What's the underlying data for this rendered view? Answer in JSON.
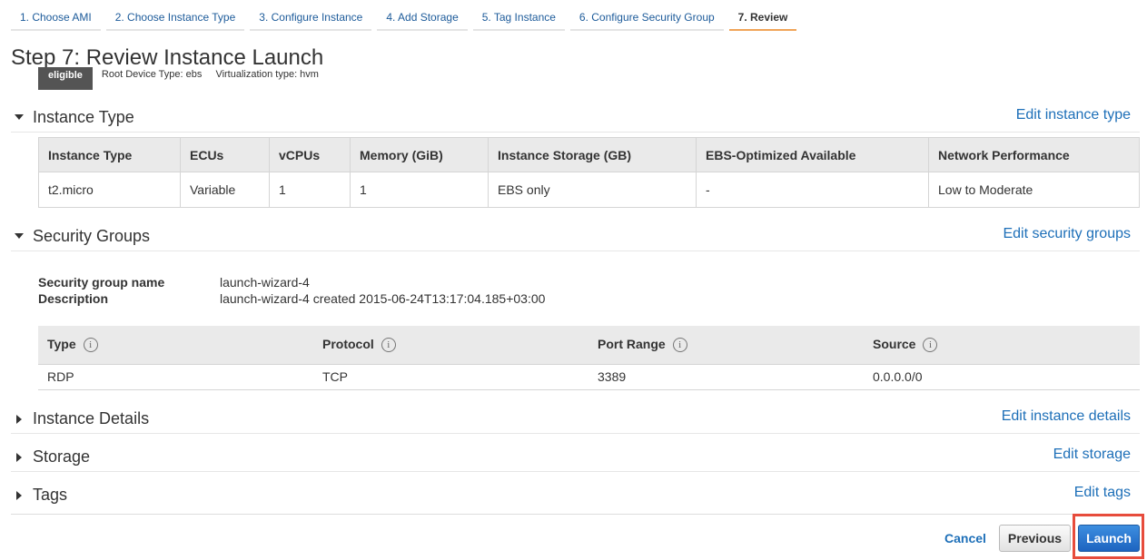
{
  "wizard": {
    "steps": [
      {
        "label": "1. Choose AMI"
      },
      {
        "label": "2. Choose Instance Type"
      },
      {
        "label": "3. Configure Instance"
      },
      {
        "label": "4. Add Storage"
      },
      {
        "label": "5. Tag Instance"
      },
      {
        "label": "6. Configure Security Group"
      },
      {
        "label": "7. Review"
      }
    ],
    "active_step": "7. Review"
  },
  "page_title": "Step 7: Review Instance Launch",
  "ami": {
    "badge": "eligible",
    "root_device": "Root Device Type: ebs",
    "virtualization": "Virtualization type: hvm"
  },
  "instance_type": {
    "title": "Instance Type",
    "edit": "Edit instance type",
    "columns": [
      "Instance Type",
      "ECUs",
      "vCPUs",
      "Memory (GiB)",
      "Instance Storage (GB)",
      "EBS-Optimized Available",
      "Network Performance"
    ],
    "row": [
      "t2.micro",
      "Variable",
      "1",
      "1",
      "EBS only",
      "-",
      "Low to Moderate"
    ]
  },
  "security_groups": {
    "title": "Security Groups",
    "edit": "Edit security groups",
    "name_label": "Security group name",
    "name_value": "launch-wizard-4",
    "desc_label": "Description",
    "desc_value": "launch-wizard-4 created 2015-06-24T13:17:04.185+03:00",
    "columns": [
      "Type",
      "Protocol",
      "Port Range",
      "Source"
    ],
    "info_glyph": "i",
    "rules": [
      [
        "RDP",
        "TCP",
        "3389",
        "0.0.0.0/0"
      ]
    ]
  },
  "instance_details": {
    "title": "Instance Details",
    "edit": "Edit instance details"
  },
  "storage": {
    "title": "Storage",
    "edit": "Edit storage"
  },
  "tags": {
    "title": "Tags",
    "edit": "Edit tags"
  },
  "actions": {
    "cancel": "Cancel",
    "previous": "Previous",
    "launch": "Launch"
  },
  "colors": {
    "link": "#1d6fb8",
    "active_tab_underline": "#f0a458",
    "launch_button": "#1d64c0",
    "highlight": "#e74c3c"
  }
}
